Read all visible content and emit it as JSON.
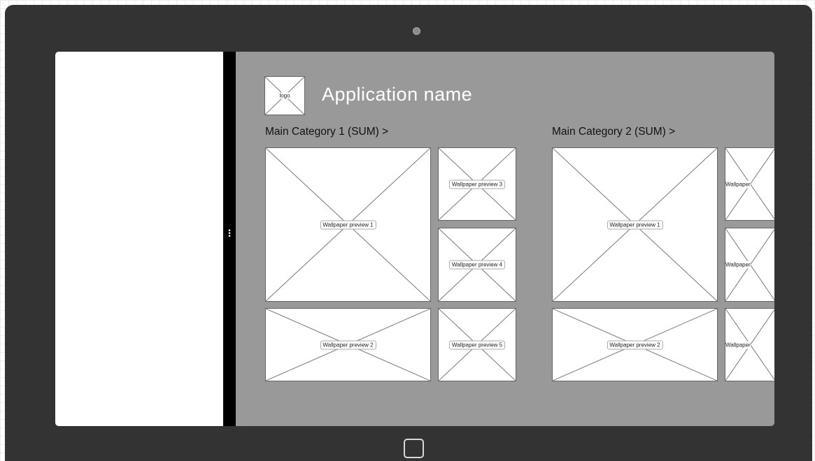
{
  "app": {
    "name": "Application name",
    "logo_label": "logo"
  },
  "categories": [
    {
      "title": "Main Category 1 (SUM) >",
      "previews": [
        "Wallpaper preview 1",
        "Wallpaper preview 2",
        "Wallpaper preview 3",
        "Wallpaper preview 4",
        "Wallpaper preview 5"
      ]
    },
    {
      "title": "Main Category 2 (SUM) >",
      "previews": [
        "Wallpaper preview 1",
        "Wallpaper preview 2",
        "Wallpaper",
        "Wallpaper",
        "Wallpaper"
      ]
    }
  ],
  "device": {
    "frame_color": "#333333",
    "screen_color": "#999999",
    "panel_color": "#ffffff",
    "splitter_color": "#000000",
    "icons": [
      "camera-icon",
      "home-button-icon",
      "grip-dots-icon",
      "placeholder-cross-icon"
    ]
  }
}
